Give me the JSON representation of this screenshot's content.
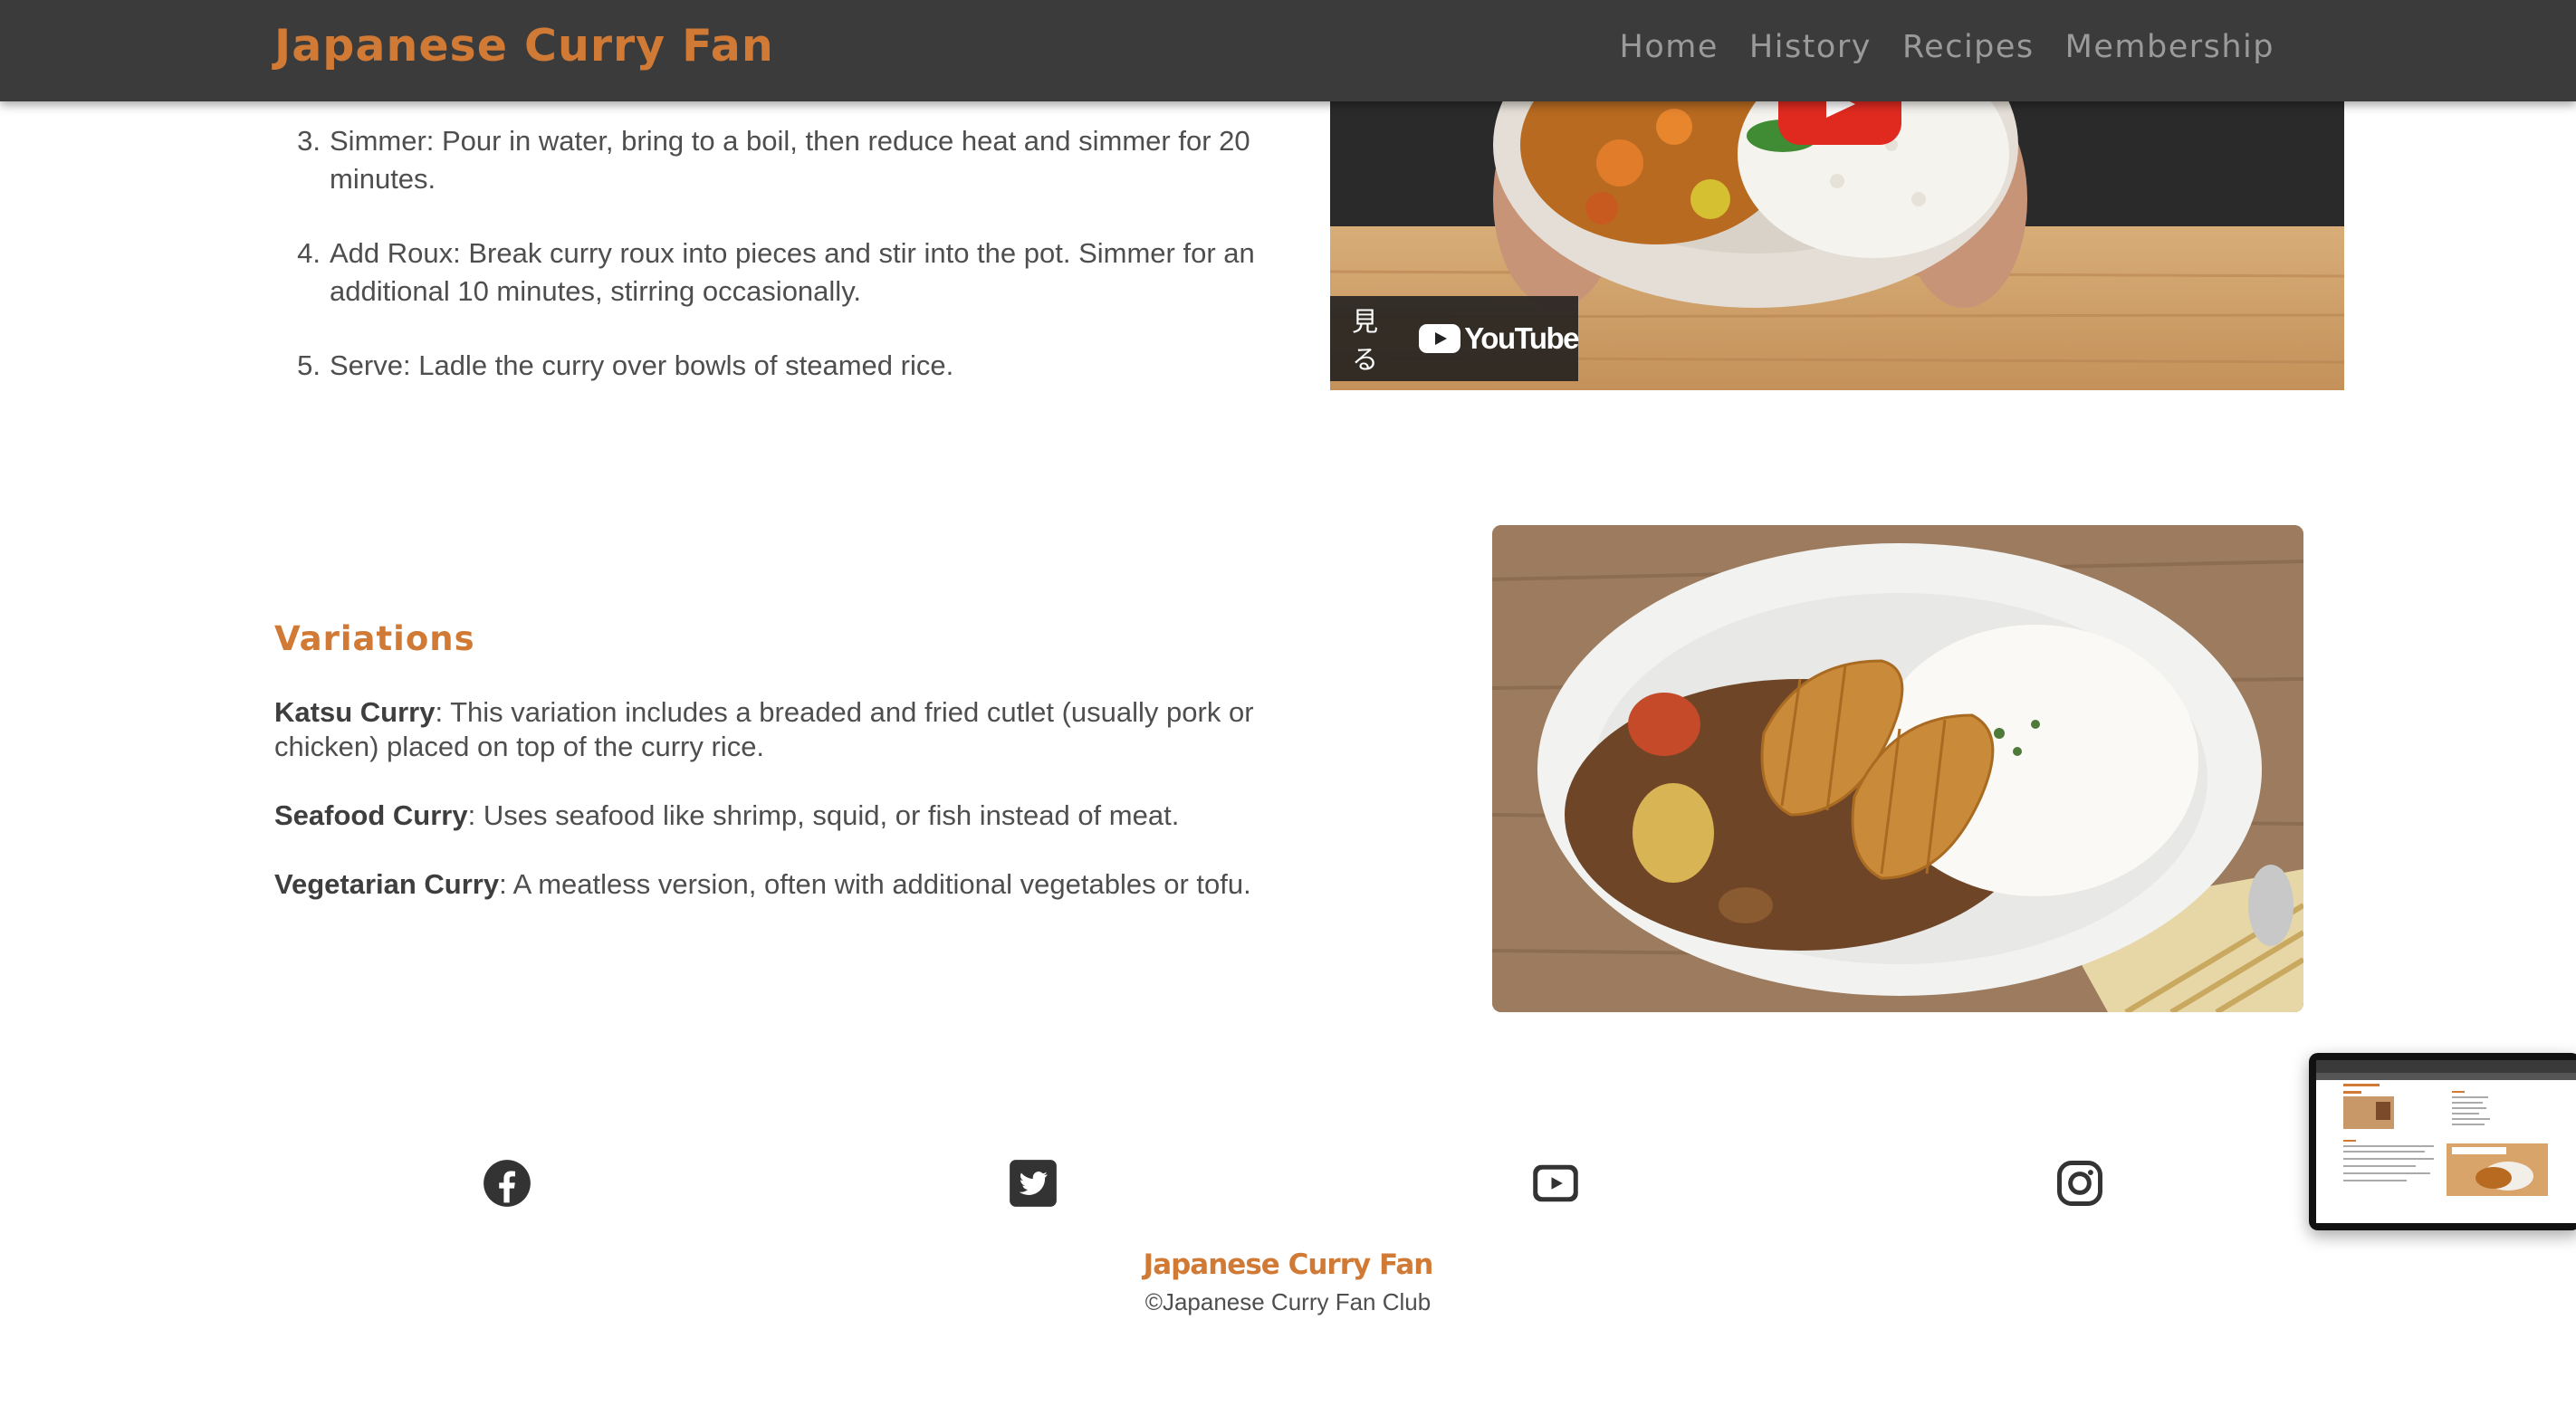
{
  "header": {
    "brand": "Japanese Curry Fan",
    "nav": [
      "Home",
      "History",
      "Recipes",
      "Membership"
    ]
  },
  "steps": [
    {
      "num": "3.",
      "text": "Simmer: Pour in water, bring to a boil, then reduce heat and simmer for 20 minutes."
    },
    {
      "num": "4.",
      "text": "Add Roux: Break curry roux into pieces and stir into the pot. Simmer for an additional 10 minutes, stirring occasionally."
    },
    {
      "num": "5.",
      "text": "Serve: Ladle the curry over bowls of steamed rice."
    }
  ],
  "video": {
    "watch_label": "見る",
    "youtube_label": "YouTube"
  },
  "variations": {
    "heading": "Variations",
    "items": [
      {
        "name": "Katsu Curry",
        "text": ": This variation includes a breaded and fried cutlet (usually pork or chicken) placed on top of the curry rice."
      },
      {
        "name": "Seafood Curry",
        "text": ": Uses seafood like shrimp, squid, or fish instead of meat."
      },
      {
        "name": "Vegetarian Curry",
        "text": ": A meatless version, often with additional vegetables or tofu."
      }
    ]
  },
  "social": [
    {
      "icon": "facebook-icon"
    },
    {
      "icon": "twitter-icon"
    },
    {
      "icon": "youtube-icon"
    },
    {
      "icon": "instagram-icon"
    }
  ],
  "footer": {
    "brand": "Japanese Curry Fan",
    "copyright": "©Japanese Curry Fan Club"
  },
  "colors": {
    "accent": "#d07a35",
    "header_bg": "#3b3b3b",
    "nav_text": "#9a9a9a",
    "body_text": "#4e4e4e"
  }
}
